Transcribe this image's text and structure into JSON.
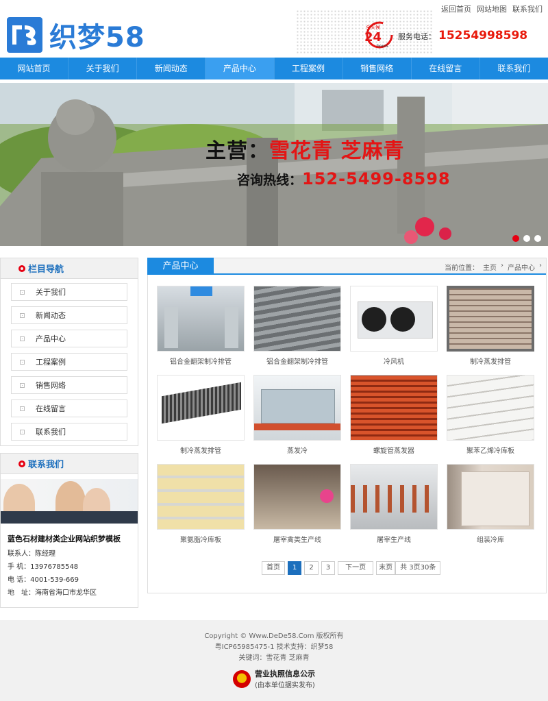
{
  "top_links": [
    "返回首页",
    "网站地图",
    "联系我们"
  ],
  "logo": {
    "text": "织梦58",
    "brand_color": "#2a7bd6"
  },
  "service": {
    "label": "服务电话：",
    "phone": "15254998598",
    "badge_top": "全天候",
    "badge_num": "24",
    "badge_sub": "hours"
  },
  "nav": {
    "items": [
      "网站首页",
      "关于我们",
      "新闻动态",
      "产品中心",
      "工程案例",
      "销售网络",
      "在线留言",
      "联系我们"
    ],
    "active_index": 3,
    "color": "#1c8ae0"
  },
  "banner": {
    "slogan_prefix": "主营：",
    "slogan_products": "雪花青 芝麻青",
    "hotline_label": "咨询热线：",
    "hotline": "152-5499-8598",
    "dots": 3,
    "active_dot": 0
  },
  "sidebar": {
    "nav_title": "栏目导航",
    "items": [
      "关于我们",
      "新闻动态",
      "产品中心",
      "工程案例",
      "销售网络",
      "在线留言",
      "联系我们"
    ],
    "contact_title": "联系我们",
    "company": "蓝色石材建材类企业网站织梦模板",
    "contact_person": "联系人：陈经理",
    "mobile": "手 机：13976785548",
    "phone": "电 话：4001-539-669",
    "address": "地　址：海南省海口市龙华区"
  },
  "main": {
    "tab_title": "产品中心",
    "breadcrumb": {
      "prefix": "当前位置：",
      "items": [
        "主页",
        "产品中心"
      ],
      "sep": "›"
    },
    "products": [
      {
        "name": "铝合金翻架制冷排管",
        "icon": "cold-room-photo"
      },
      {
        "name": "铝合金翻架制冷排管",
        "icon": "ceiling-pipe-photo"
      },
      {
        "name": "冷风机",
        "icon": "air-cooler-photo"
      },
      {
        "name": "制冷蒸发排管",
        "icon": "coil-pipe-photo"
      },
      {
        "name": "制冷蒸发排管",
        "icon": "evaporator-rack-photo"
      },
      {
        "name": "蒸发冷",
        "icon": "evaporative-condenser-photo"
      },
      {
        "name": "螺旋管蒸发器",
        "icon": "spiral-evaporator-photo"
      },
      {
        "name": "聚苯乙烯冷库板",
        "icon": "eps-panel-photo"
      },
      {
        "name": "聚氨脂冷库板",
        "icon": "pu-panel-photo"
      },
      {
        "name": "屠宰禽类生产线",
        "icon": "poultry-line-photo"
      },
      {
        "name": "屠宰生产线",
        "icon": "slaughter-line-photo"
      },
      {
        "name": "组装冷库",
        "icon": "assembled-cold-room-photo"
      }
    ],
    "pagination": {
      "first": "首页",
      "pages": [
        "1",
        "2",
        "3"
      ],
      "current": "1",
      "next": "下一页",
      "last": "末页",
      "info": "共 3页30条"
    }
  },
  "footer": {
    "copyright": "Copyright © Www.DeDe58.Com 版权所有",
    "icp": "粤ICP65985475-1 技术支持：织梦58",
    "keywords": "关键词：雪花青 芝麻青",
    "license_title": "营业执照信息公示",
    "license_sub": "(由本单位据实发布)"
  }
}
